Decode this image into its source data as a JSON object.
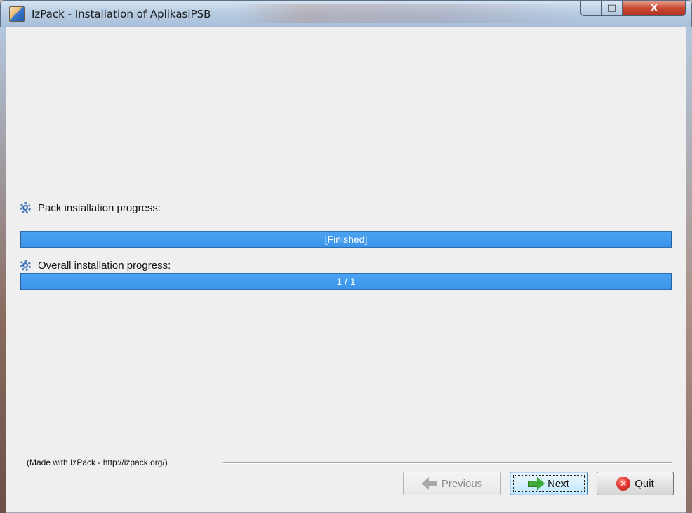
{
  "window": {
    "title": "IzPack - Installation of AplikasiPSB",
    "minimize_glyph": "—",
    "maximize_glyph": "□",
    "close_glyph": "X"
  },
  "pack_progress": {
    "label": "Pack installation progress:",
    "status": "[Finished]",
    "value": 1.0
  },
  "overall_progress": {
    "label": "Overall installation progress:",
    "status": "1 / 1",
    "value": 1.0
  },
  "footer": {
    "credit": "(Made with IzPack - http://izpack.org/)"
  },
  "buttons": {
    "previous": "Previous",
    "next": "Next",
    "quit": "Quit",
    "quit_glyph": "✕"
  },
  "colors": {
    "progress_fill": "#3b94e8",
    "client_bg": "#efefef"
  }
}
